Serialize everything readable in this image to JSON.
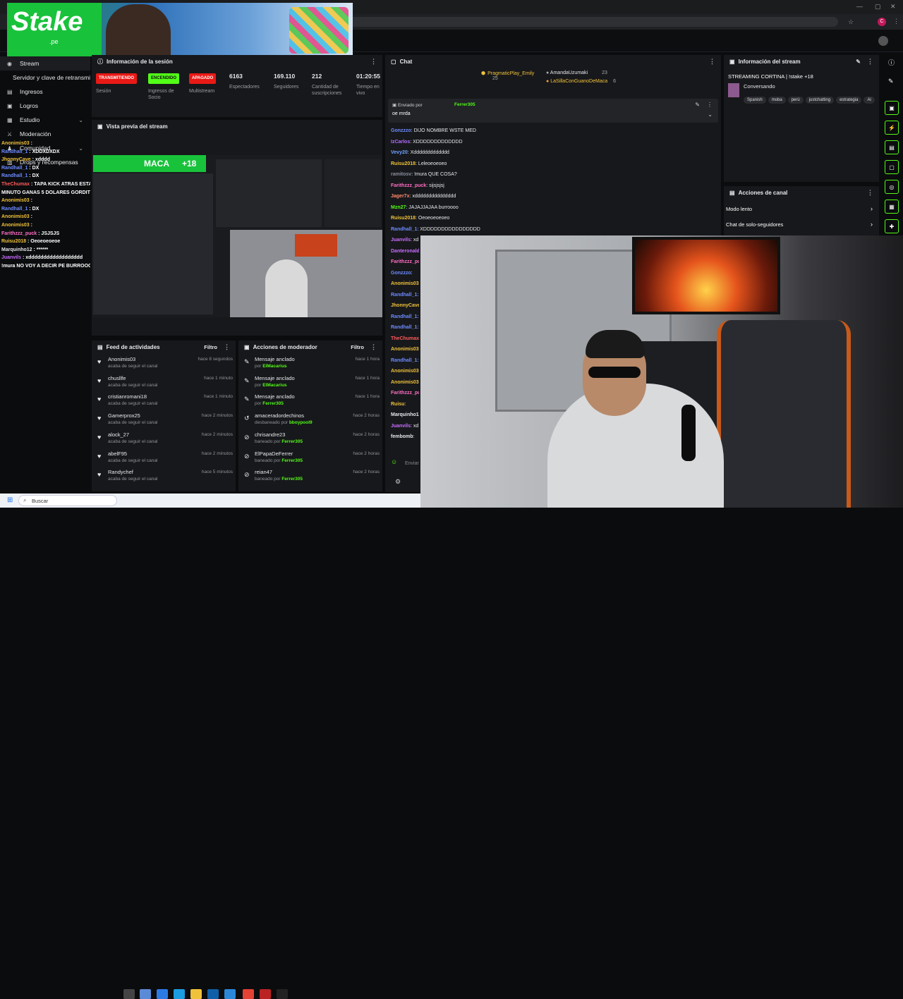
{
  "browser": {
    "window_controls": [
      "—",
      "▢",
      "✕"
    ],
    "profile_initial": "C"
  },
  "ad": {
    "brand": "Stake",
    "brand_sub": ".pe"
  },
  "sidebar": {
    "items": [
      {
        "label": "Stream",
        "icon": "broadcast-icon"
      },
      {
        "label": "Servidor y clave de retransmisión",
        "icon": ""
      },
      {
        "label": "Ingresos",
        "icon": "wallet-icon"
      },
      {
        "label": "Logros",
        "icon": "trophy-icon"
      },
      {
        "label": "Estudio",
        "icon": "studio-icon"
      },
      {
        "label": "Moderación",
        "icon": "sword-icon"
      },
      {
        "label": "Comunidad",
        "icon": "users-icon"
      },
      {
        "label": "Drops y recompensas",
        "icon": "gift-icon"
      }
    ]
  },
  "session": {
    "title": "Información de la sesión",
    "badges": [
      {
        "text": "TRANSMITIENDO",
        "label": "Sesión",
        "color": "#e91916"
      },
      {
        "text": "ENCENDIDO",
        "label": "Ingresos de Socio",
        "color": "#53fc18"
      },
      {
        "text": "APAGADO",
        "label": "Multistream",
        "color": "#e91916"
      }
    ],
    "stats": [
      {
        "value": "6163",
        "label": "Espectadores"
      },
      {
        "value": "169.110",
        "label": "Seguidores"
      },
      {
        "value": "212",
        "label": "Cantidad de suscripciones"
      },
      {
        "value": "01:20:55",
        "label": "Tiempo en vivo"
      }
    ]
  },
  "preview": {
    "title": "Vista previa del stream",
    "overlay_name": "MACA",
    "overlay_tag": "+18"
  },
  "feed": {
    "title": "Feed de actividades",
    "filter": "Filtro",
    "rows": [
      {
        "name": "Anonimis03",
        "sub": "acaba de seguir el canal",
        "time": "hace 8 segundos"
      },
      {
        "name": "chusllfe",
        "sub": "acaba de seguir el canal",
        "time": "hace 1 minuto"
      },
      {
        "name": "cristianromani18",
        "sub": "acaba de seguir el canal",
        "time": "hace 1 minuto"
      },
      {
        "name": "Gamerprox25",
        "sub": "acaba de seguir el canal",
        "time": "hace 2 minutos"
      },
      {
        "name": "alock_27",
        "sub": "acaba de seguir el canal",
        "time": "hace 2 minutos"
      },
      {
        "name": "abelF95",
        "sub": "acaba de seguir el canal",
        "time": "hace 2 minutos"
      },
      {
        "name": "Randychef",
        "sub": "acaba de seguir el canal",
        "time": "hace 5 minutos"
      }
    ]
  },
  "mod": {
    "title": "Acciones de moderador",
    "filter": "Filtro",
    "rows": [
      {
        "icon": "pin-icon",
        "name": "Mensaje anclado",
        "pre": "por",
        "user": "ElMacarius",
        "time": "hace 1 hora"
      },
      {
        "icon": "pin-icon",
        "name": "Mensaje anclado",
        "pre": "por",
        "user": "ElMacarius",
        "time": "hace 1 hora"
      },
      {
        "icon": "pin-icon",
        "name": "Mensaje anclado",
        "pre": "por",
        "user": "Ferrer305",
        "time": "hace 1 hora"
      },
      {
        "icon": "undo-icon",
        "name": "amaceradordechinos",
        "pre": "desbaneado por",
        "user": "bboypool9",
        "time": "hace 2 horas"
      },
      {
        "icon": "ban-icon",
        "name": "chrisandre23",
        "pre": "baneado por",
        "user": "Ferrer305",
        "time": "hace 2 horas"
      },
      {
        "icon": "ban-icon",
        "name": "ElPapaDeFerrer",
        "pre": "baneado por",
        "user": "Ferrer305",
        "time": "hace 2 horas"
      },
      {
        "icon": "ban-icon",
        "name": "reian47",
        "pre": "baneado por",
        "user": "Ferrer305",
        "time": "hace 2 horas"
      }
    ]
  },
  "chat": {
    "title": "Chat",
    "gifters": [
      {
        "name": "PragmaticPlay_Emily",
        "count": "25"
      },
      {
        "name": "AmandaUzumaki",
        "count": "23"
      },
      {
        "name": "LaSillaConGuanoDeMaca",
        "count": "6"
      }
    ],
    "pinned": {
      "label": "Enviado por",
      "user": "Ferrer305",
      "text": "oe mrda"
    },
    "messages": [
      {
        "user": "Gonzzzo",
        "text": "DIJO NOMBRE WSTE MED",
        "color": "#6d8bff"
      },
      {
        "user": "IzCarlos",
        "text": "XDDDDDDDDDDDDD",
        "color": "#b26dff"
      },
      {
        "user": "Vevy20",
        "text": "Xddddddddddddd",
        "color": "#6da2ff"
      },
      {
        "user": "Ruisu2018",
        "text": "Leleoeoeoeo",
        "color": "#f0c23a"
      },
      {
        "user": "ramitosv",
        "text": "!mura QUE COSA?",
        "color": "#8a8fa0"
      },
      {
        "user": "Farithzzz_puck",
        "text": "sijsjsjsj",
        "color": "#ff6dc4"
      },
      {
        "user": "Jager7x",
        "text": "xddddddddddddddd",
        "color": "#ff8a6d"
      },
      {
        "user": "Mzn27",
        "text": "JAJAJJAJAA burroooo",
        "color": "#53fc18"
      },
      {
        "user": "Ruisu2018",
        "text": "Oeoeoeoeoeo",
        "color": "#f0c23a"
      },
      {
        "user": "Randhall_1",
        "text": "XDDDDDDDDDDDDDDDD",
        "color": "#6d8bff"
      },
      {
        "user": "Juanvils",
        "text": "xd",
        "color": "#c86dff"
      },
      {
        "user": "Danteronald",
        "text": "",
        "color": "#c86dff"
      },
      {
        "user": "Farithzzz_pu",
        "text": "",
        "color": "#ff6dc4"
      },
      {
        "user": "Gonzzzo",
        "text": "",
        "color": "#6d8bff"
      },
      {
        "user": "Anonimis03",
        "text": "",
        "color": "#f0c23a"
      },
      {
        "user": "Randhall_1",
        "text": "X",
        "color": "#6d8bff"
      },
      {
        "user": "JhonnyCave",
        "text": "",
        "color": "#f0c23a"
      },
      {
        "user": "Randhall_1",
        "text": "D",
        "color": "#6d8bff"
      },
      {
        "user": "Randhall_1",
        "text": "D",
        "color": "#6d8bff"
      },
      {
        "user": "TheChumax",
        "text": "",
        "color": "#ff5a5a"
      },
      {
        "user": "Anonimis03",
        "text": "",
        "color": "#f0c23a"
      },
      {
        "user": "Randhall_1",
        "text": "D",
        "color": "#6d8bff"
      },
      {
        "user": "Anonimis03",
        "text": "",
        "color": "#f0c23a"
      },
      {
        "user": "Anonimis03",
        "text": "",
        "color": "#f0c23a"
      },
      {
        "user": "Farithzzz_pu",
        "text": "",
        "color": "#ff6dc4"
      },
      {
        "user": "Ruisu",
        "text": "",
        "color": "#f0c23a"
      },
      {
        "user": "Marquinho12",
        "text": "",
        "color": "#e6e7ea"
      },
      {
        "user": "Juanvils",
        "text": "xd",
        "color": "#c86dff"
      },
      {
        "user": "fembomb",
        "text": "",
        "color": "#e6e7ea"
      }
    ],
    "input_placeholder": "Enviar",
    "send": "Chat"
  },
  "overlay_chat": [
    {
      "user": "Anonimis03",
      "text": "",
      "color": "#f0c23a"
    },
    {
      "user": "Randhall_1",
      "text": "XDDXDXDX",
      "color": "#6d8bff"
    },
    {
      "user": "JhonnyCave",
      "text": "xdddd",
      "color": "#f0c23a"
    },
    {
      "user": "Randhall_1",
      "text": "DX",
      "color": "#6d8bff"
    },
    {
      "user": "Randhall_1",
      "text": "DX",
      "color": "#6d8bff"
    },
    {
      "user": "TheChumax",
      "text": "TAPA KICK ATRAS ESTA QUE SE FILTRA QUE POR",
      "color": "#ff5a5a"
    },
    {
      "user": "",
      "text": "MINUTO GANAS 5 DOLARES GORDITO",
      "color": "#ffffff"
    },
    {
      "user": "Anonimis03",
      "text": "",
      "color": "#f0c23a"
    },
    {
      "user": "Randhall_1",
      "text": "DX",
      "color": "#6d8bff"
    },
    {
      "user": "Anonimis03",
      "text": "",
      "color": "#f0c23a"
    },
    {
      "user": "Anonimis03",
      "text": "",
      "color": "#f0c23a"
    },
    {
      "user": "Farithzzz_puck",
      "text": "JSJSJS",
      "color": "#ff6dc4"
    },
    {
      "user": "Ruisu2018",
      "text": "Oeoeoeoeoe",
      "color": "#f0c23a"
    },
    {
      "user": "Marquinho12",
      "text": "******",
      "color": "#e6e7ea"
    },
    {
      "user": "Juanvils",
      "text": "xdddddddddddddddddd",
      "color": "#c86dff"
    },
    {
      "user": "",
      "text": "!mura NO VOY A DECIR PE BURROOOO",
      "color": "#ffffff"
    }
  ],
  "stream_info": {
    "title": "Información del stream",
    "stream_title": "STREAMING CORTINA | !stake +18",
    "category": "Conversando",
    "tags": [
      "Spanish",
      "moba",
      "perú",
      "justchatting",
      "estrategia",
      "Ai"
    ]
  },
  "channel_actions": {
    "title": "Acciones de canal",
    "items": [
      "Modo lento",
      "Chat de solo-seguidores"
    ]
  },
  "taskbar": {
    "search": "Buscar"
  }
}
